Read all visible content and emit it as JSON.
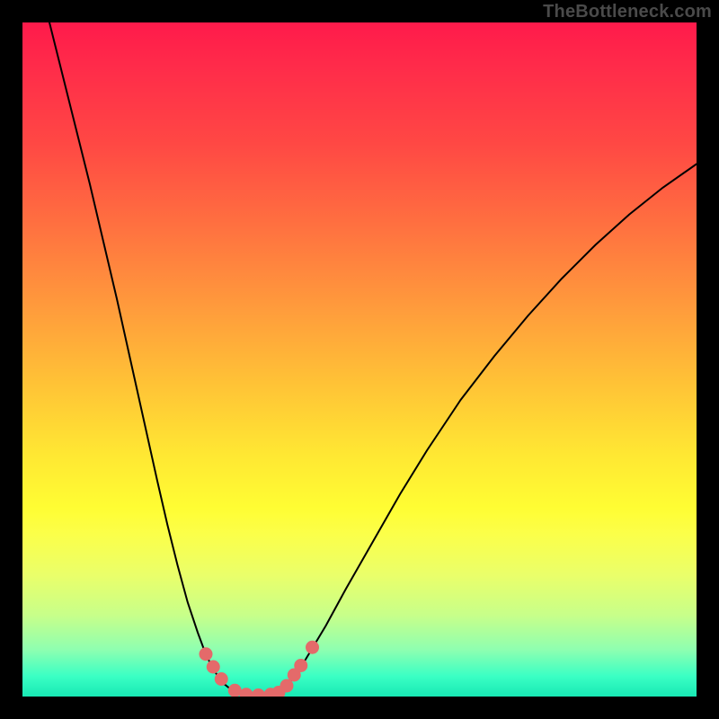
{
  "watermark": "TheBottleneck.com",
  "chart_data": {
    "type": "line",
    "title": "",
    "xlabel": "",
    "ylabel": "",
    "xlim": [
      0,
      100
    ],
    "ylim": [
      0,
      100
    ],
    "grid": false,
    "legend": false,
    "gradient_colors": {
      "top": "#ff1a4b",
      "mid": "#fffd33",
      "bottom": "#18e9b4"
    },
    "series": [
      {
        "name": "bottleneck-curve-left",
        "color": "#000000",
        "x": [
          4.0,
          6.0,
          8.0,
          10.0,
          12.0,
          14.0,
          16.0,
          18.0,
          20.0,
          21.5,
          23.0,
          24.5,
          26.0,
          27.0,
          28.0,
          29.0,
          30.0,
          31.0,
          32.0
        ],
        "values": [
          100.0,
          92.0,
          84.0,
          76.0,
          67.5,
          59.0,
          50.0,
          41.0,
          32.0,
          25.5,
          19.5,
          14.0,
          9.5,
          6.8,
          4.6,
          3.0,
          1.8,
          1.0,
          0.4
        ]
      },
      {
        "name": "bottleneck-curve-flat",
        "color": "#000000",
        "x": [
          32.0,
          33.0,
          34.0,
          35.0,
          36.0,
          37.0,
          38.0
        ],
        "values": [
          0.4,
          0.2,
          0.15,
          0.15,
          0.2,
          0.3,
          0.5
        ]
      },
      {
        "name": "bottleneck-curve-right",
        "color": "#000000",
        "x": [
          38.0,
          40.0,
          42.0,
          45.0,
          48.0,
          52.0,
          56.0,
          60.0,
          65.0,
          70.0,
          75.0,
          80.0,
          85.0,
          90.0,
          95.0,
          100.0
        ],
        "values": [
          0.5,
          2.5,
          5.5,
          10.5,
          16.0,
          23.0,
          30.0,
          36.5,
          44.0,
          50.5,
          56.5,
          62.0,
          67.0,
          71.5,
          75.5,
          79.0
        ]
      },
      {
        "name": "highlight-dots",
        "color": "#e46a6a",
        "type": "scatter",
        "x": [
          27.2,
          28.3,
          29.5,
          31.5,
          33.2,
          35.0,
          36.8,
          38.0,
          39.2,
          40.3,
          41.3,
          43.0
        ],
        "values": [
          6.3,
          4.4,
          2.6,
          0.9,
          0.3,
          0.2,
          0.3,
          0.6,
          1.6,
          3.2,
          4.6,
          7.3
        ]
      }
    ]
  }
}
